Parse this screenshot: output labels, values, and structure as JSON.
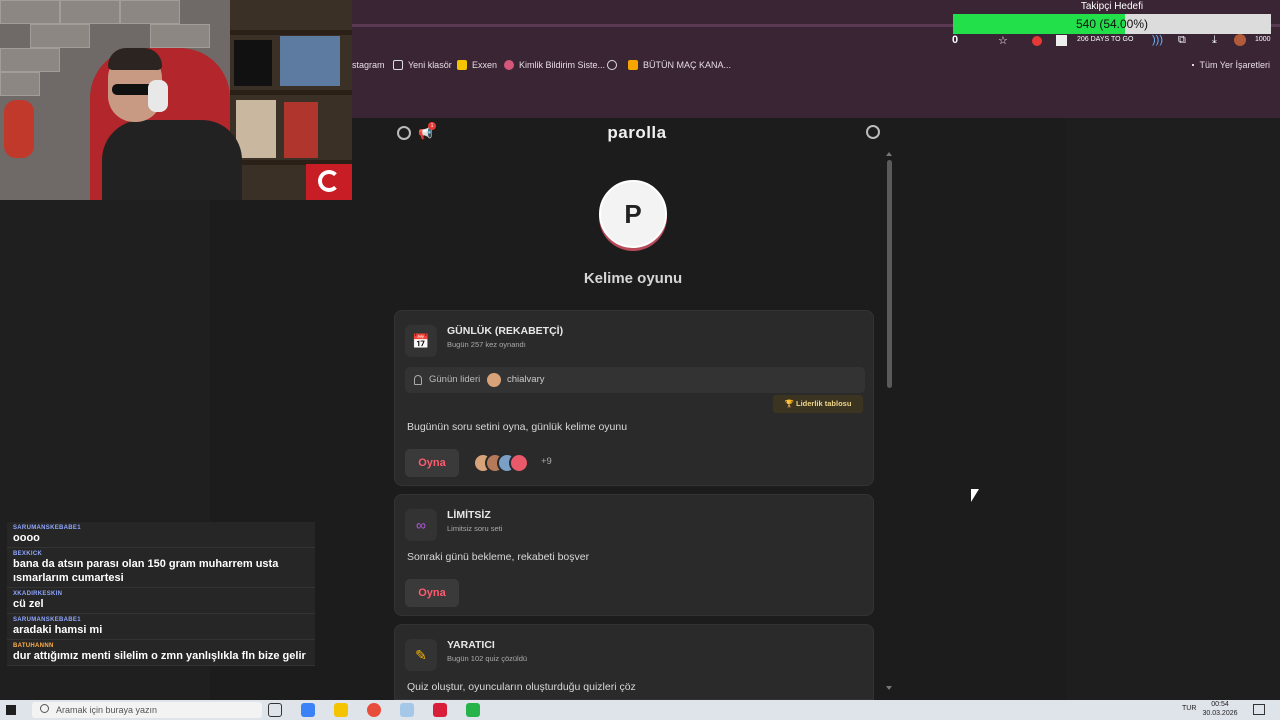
{
  "follower_goal": {
    "title": "Takipçi Hedefi",
    "value_text": "540 (54.00%)",
    "progress": 0.54
  },
  "toolbar": {
    "count": "0",
    "days_text": "206 DAYS TO GO",
    "follower_count": "1000"
  },
  "bookmarks": {
    "items": [
      "stagram",
      "Yeni klasör",
      "Exxen",
      "Kimlik Bildirim Siste...",
      "BÜTÜN MAÇ KANA..."
    ],
    "right_folder": "Tüm Yer İşaretleri"
  },
  "app": {
    "logo": "parolla",
    "notification_count": "1",
    "avatar_letter": "P",
    "subtitle": "Kelime oyunu"
  },
  "cards": {
    "daily": {
      "title": "GÜNLÜK (REKABETÇİ)",
      "sub": "Bugün 257 kez oynandı",
      "leader_label": "Günün lideri",
      "leader_name": "chialvary",
      "leaderboard": "🏆 Liderlik tablosu",
      "desc": "Bugünün soru setini oyna, günlük kelime oyunu",
      "play": "Oyna",
      "more_players": "+9"
    },
    "unlimited": {
      "title": "LİMİTSİZ",
      "sub": "Limitsiz soru seti",
      "desc": "Sonraki günü bekleme, rekabeti boşver",
      "play": "Oyna"
    },
    "creative": {
      "title": "YARATICI",
      "sub": "Bugün 102 quiz çözüldü",
      "desc": "Quiz oluştur, oyuncuların oluşturduğu quizleri çöz"
    }
  },
  "chat": [
    {
      "user": "SARUMANSKEBABE1",
      "text": "oooo"
    },
    {
      "user": "BEXKICK",
      "text": "bana da atsın parası olan 150 gram muharrem usta ısmarlarım cumartesi"
    },
    {
      "user": "XKADIRKESKIN",
      "text": "cü zel"
    },
    {
      "user": "SARUMANSKEBABE1",
      "text": "aradaki hamsi mi"
    },
    {
      "user": "BATUHANNN",
      "text": "dur attığımız menti silelim o zmn yanlışlıkla fln bize gelir"
    }
  ],
  "taskbar": {
    "search_placeholder": "Aramak için buraya yazın",
    "lang": "TUR",
    "time": "00:54",
    "date": "30.03.2026"
  },
  "colors": {
    "accent": "#ff5b6e",
    "progress": "#22e04a",
    "chrome": "#3a2535"
  }
}
